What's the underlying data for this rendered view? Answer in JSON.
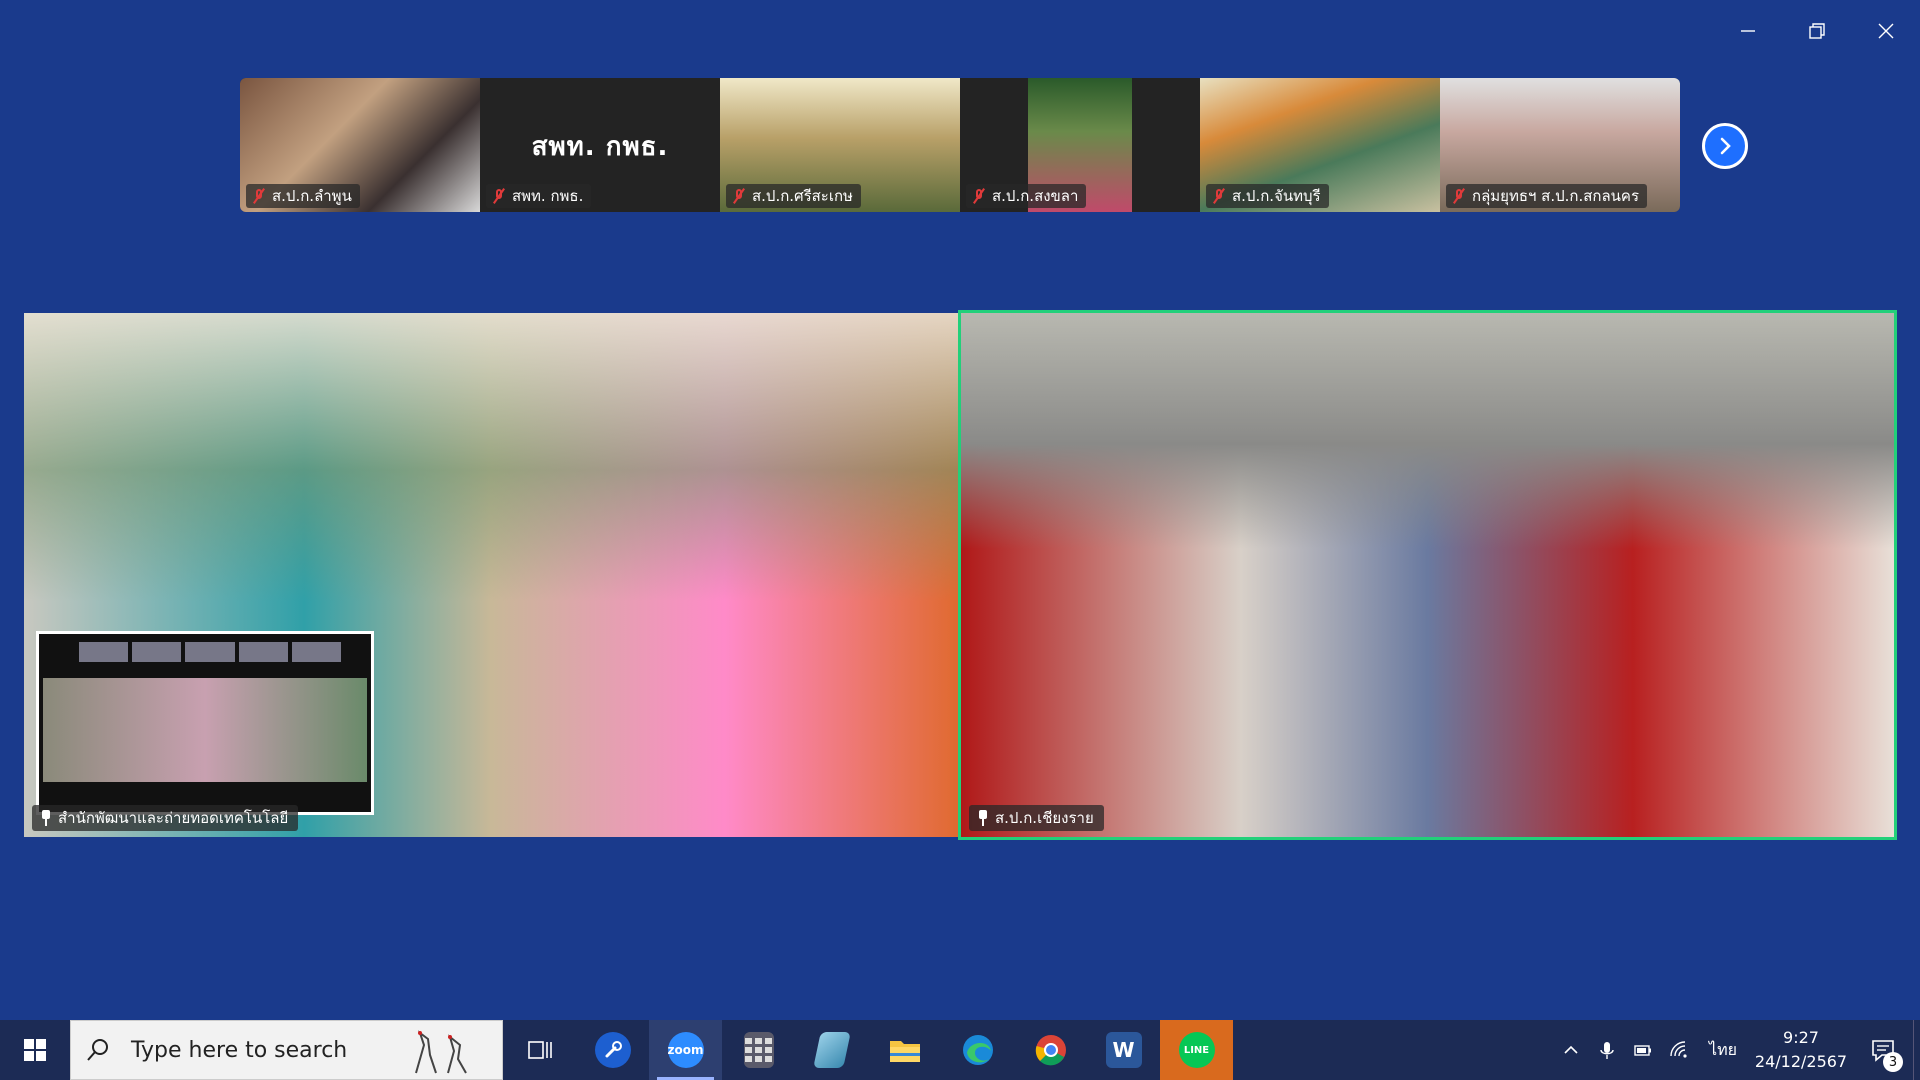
{
  "window": {
    "controls": [
      "minimize",
      "restore",
      "close"
    ]
  },
  "participants_strip": [
    {
      "label": "ส.ป.ก.ลำพูน",
      "muted": true,
      "bg": "#6b4a3a"
    },
    {
      "label": "สพท. กพธ.",
      "muted": true,
      "bg": "#232323",
      "placeholder_text": "สพท. กพธ."
    },
    {
      "label": "ส.ป.ก.ศรีสะเกษ",
      "muted": true,
      "bg": "#8a7a50"
    },
    {
      "label": "ส.ป.ก.สงขลา",
      "muted": true,
      "bg": "#3c5a2a"
    },
    {
      "label": "ส.ป.ก.จันทบุรี",
      "muted": true,
      "bg": "#7a8a60"
    },
    {
      "label": "กลุ่มยุทธฯ ส.ป.ก.สกลนคร",
      "muted": true,
      "bg": "#8a8070"
    }
  ],
  "main_tiles": {
    "left": {
      "label": "สำนักพัฒนาและถ่ายทอดเทคโนโลยี",
      "pinned": true
    },
    "right": {
      "label": "ส.ป.ก.เชียงราย",
      "pinned": true,
      "active_speaker": true
    }
  },
  "taskbar": {
    "search_placeholder": "Type here to search",
    "apps": [
      {
        "name": "task-view",
        "label": ""
      },
      {
        "name": "app-blue-wrench",
        "label": ""
      },
      {
        "name": "zoom",
        "label": "zoom"
      },
      {
        "name": "calculator",
        "label": ""
      },
      {
        "name": "notepad-app",
        "label": ""
      },
      {
        "name": "file-explorer",
        "label": ""
      },
      {
        "name": "edge",
        "label": ""
      },
      {
        "name": "chrome",
        "label": ""
      },
      {
        "name": "word",
        "label": "W"
      },
      {
        "name": "line",
        "label": "LINE"
      }
    ],
    "language": "ไทย",
    "time": "9:27",
    "date": "24/12/2567",
    "notification_count": "3"
  },
  "colors": {
    "background": "#1a3a8c",
    "active_speaker_border": "#22d07a",
    "taskbar": "#1c2b55",
    "muted_icon": "#e03a3a"
  }
}
